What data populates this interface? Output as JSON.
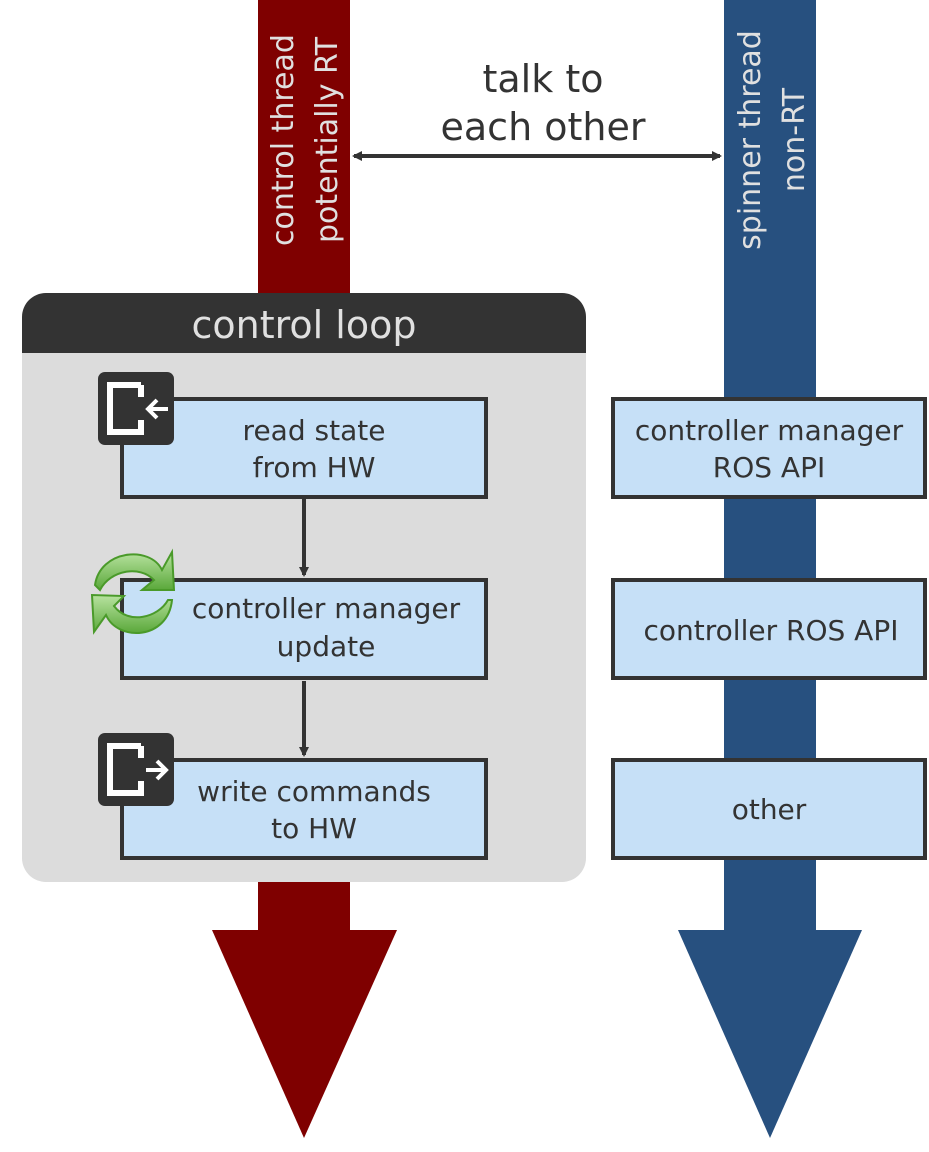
{
  "colors": {
    "control_thread": "#7f0000",
    "spinner_thread": "#27507f",
    "box_fill": "#c6e0f7",
    "panel": "#dcdcdc",
    "panel_header": "#333333"
  },
  "control_thread": {
    "line1": "control thread",
    "line2": "potentially RT"
  },
  "spinner_thread": {
    "line1": "spinner thread",
    "line2": "non-RT"
  },
  "link": {
    "line1": "talk to",
    "line2": "each other"
  },
  "control_loop": {
    "title": "control loop",
    "steps": [
      {
        "line1": "read state",
        "line2": "from HW",
        "icon": "import-icon"
      },
      {
        "line1": "controller manager",
        "line2": "update",
        "icon": "refresh-icon"
      },
      {
        "line1": "write commands",
        "line2": "to HW",
        "icon": "export-icon"
      }
    ]
  },
  "spinner_boxes": [
    {
      "line1": "controller manager",
      "line2": "ROS API"
    },
    {
      "line1": "controller ROS API"
    },
    {
      "line1": "other"
    }
  ]
}
